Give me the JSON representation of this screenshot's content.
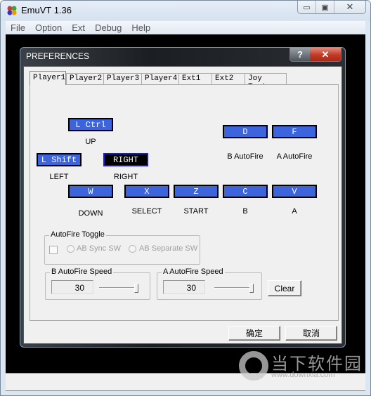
{
  "window": {
    "title": "EmuVT 1.36",
    "controls": {
      "minimize": "▭",
      "maximize": "▣",
      "close": "✕"
    }
  },
  "menu": [
    "File",
    "Option",
    "Ext",
    "Debug",
    "Help"
  ],
  "dialog": {
    "title": "PREFERENCES",
    "help_glyph": "?",
    "close_glyph": "✕",
    "tabs": [
      "Player1",
      "Player2",
      "Player3",
      "Player4",
      "Ext1",
      "Ext2",
      "Joy Test"
    ],
    "active_tab": "Player1",
    "bindings": {
      "up": {
        "key": "L Ctrl",
        "label": "UP"
      },
      "left": {
        "key": "L Shift",
        "label": "LEFT"
      },
      "right": {
        "key": "RIGHT",
        "label": "RIGHT",
        "selected": true
      },
      "down": {
        "key": "W",
        "label": "DOWN"
      },
      "select": {
        "key": "X",
        "label": "SELECT"
      },
      "start": {
        "key": "Z",
        "label": "START"
      },
      "b": {
        "key": "C",
        "label": "B"
      },
      "a": {
        "key": "V",
        "label": "A"
      },
      "b_autofire": {
        "key": "D",
        "label": "B AutoFire"
      },
      "a_autofire": {
        "key": "F",
        "label": "A AutoFire"
      }
    },
    "autofire_toggle": {
      "title": "AutoFire Toggle",
      "checked": false,
      "options": [
        "AB Sync SW",
        "AB Separate SW"
      ]
    },
    "b_speed": {
      "title": "B AutoFire Speed",
      "value": "30"
    },
    "a_speed": {
      "title": "A AutoFire Speed",
      "value": "30"
    },
    "clear_label": "Clear",
    "ok_label": "确定",
    "cancel_label": "取消"
  },
  "watermark": {
    "text": "当下软件园",
    "url": "www.downxia.com"
  },
  "colors": {
    "key_bg": "#3c64dc",
    "key_selected_bg": "#000000",
    "close_red": "#c23a26"
  }
}
